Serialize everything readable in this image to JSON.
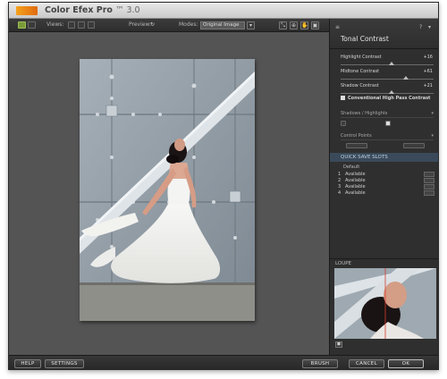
{
  "window": {
    "title": "Color Efex Pro",
    "version": "™ 3.0"
  },
  "toolbar": {
    "views_label": "Views:",
    "preview_label": "Preview:",
    "modes_label": "Modes:",
    "mode_value": "Original Image"
  },
  "panel": {
    "filter_title": "Tonal Contrast",
    "sliders": [
      {
        "label": "Highlight Contrast",
        "value": "+16",
        "level": 0.55
      },
      {
        "label": "Midtone Contrast",
        "value": "+61",
        "level": 0.7
      },
      {
        "label": "Shadow Contrast",
        "value": "+21",
        "level": 0.55
      }
    ],
    "checkbox_label": "Conventional High Pass Contrast",
    "shadows_highlights_label": "Shadows / Highlights",
    "control_points_label": "Control Points",
    "quick_save_title": "QUICK SAVE SLOTS",
    "quick_save_default": "Default",
    "quick_save_slots": [
      {
        "num": "1",
        "status": "Available"
      },
      {
        "num": "2",
        "status": "Available"
      },
      {
        "num": "3",
        "status": "Available"
      },
      {
        "num": "4",
        "status": "Available"
      }
    ],
    "loupe_title": "LOUPE"
  },
  "bottom": {
    "help": "HELP",
    "settings": "SETTINGS",
    "brush": "BRUSH",
    "cancel": "CANCEL",
    "ok": "OK"
  }
}
